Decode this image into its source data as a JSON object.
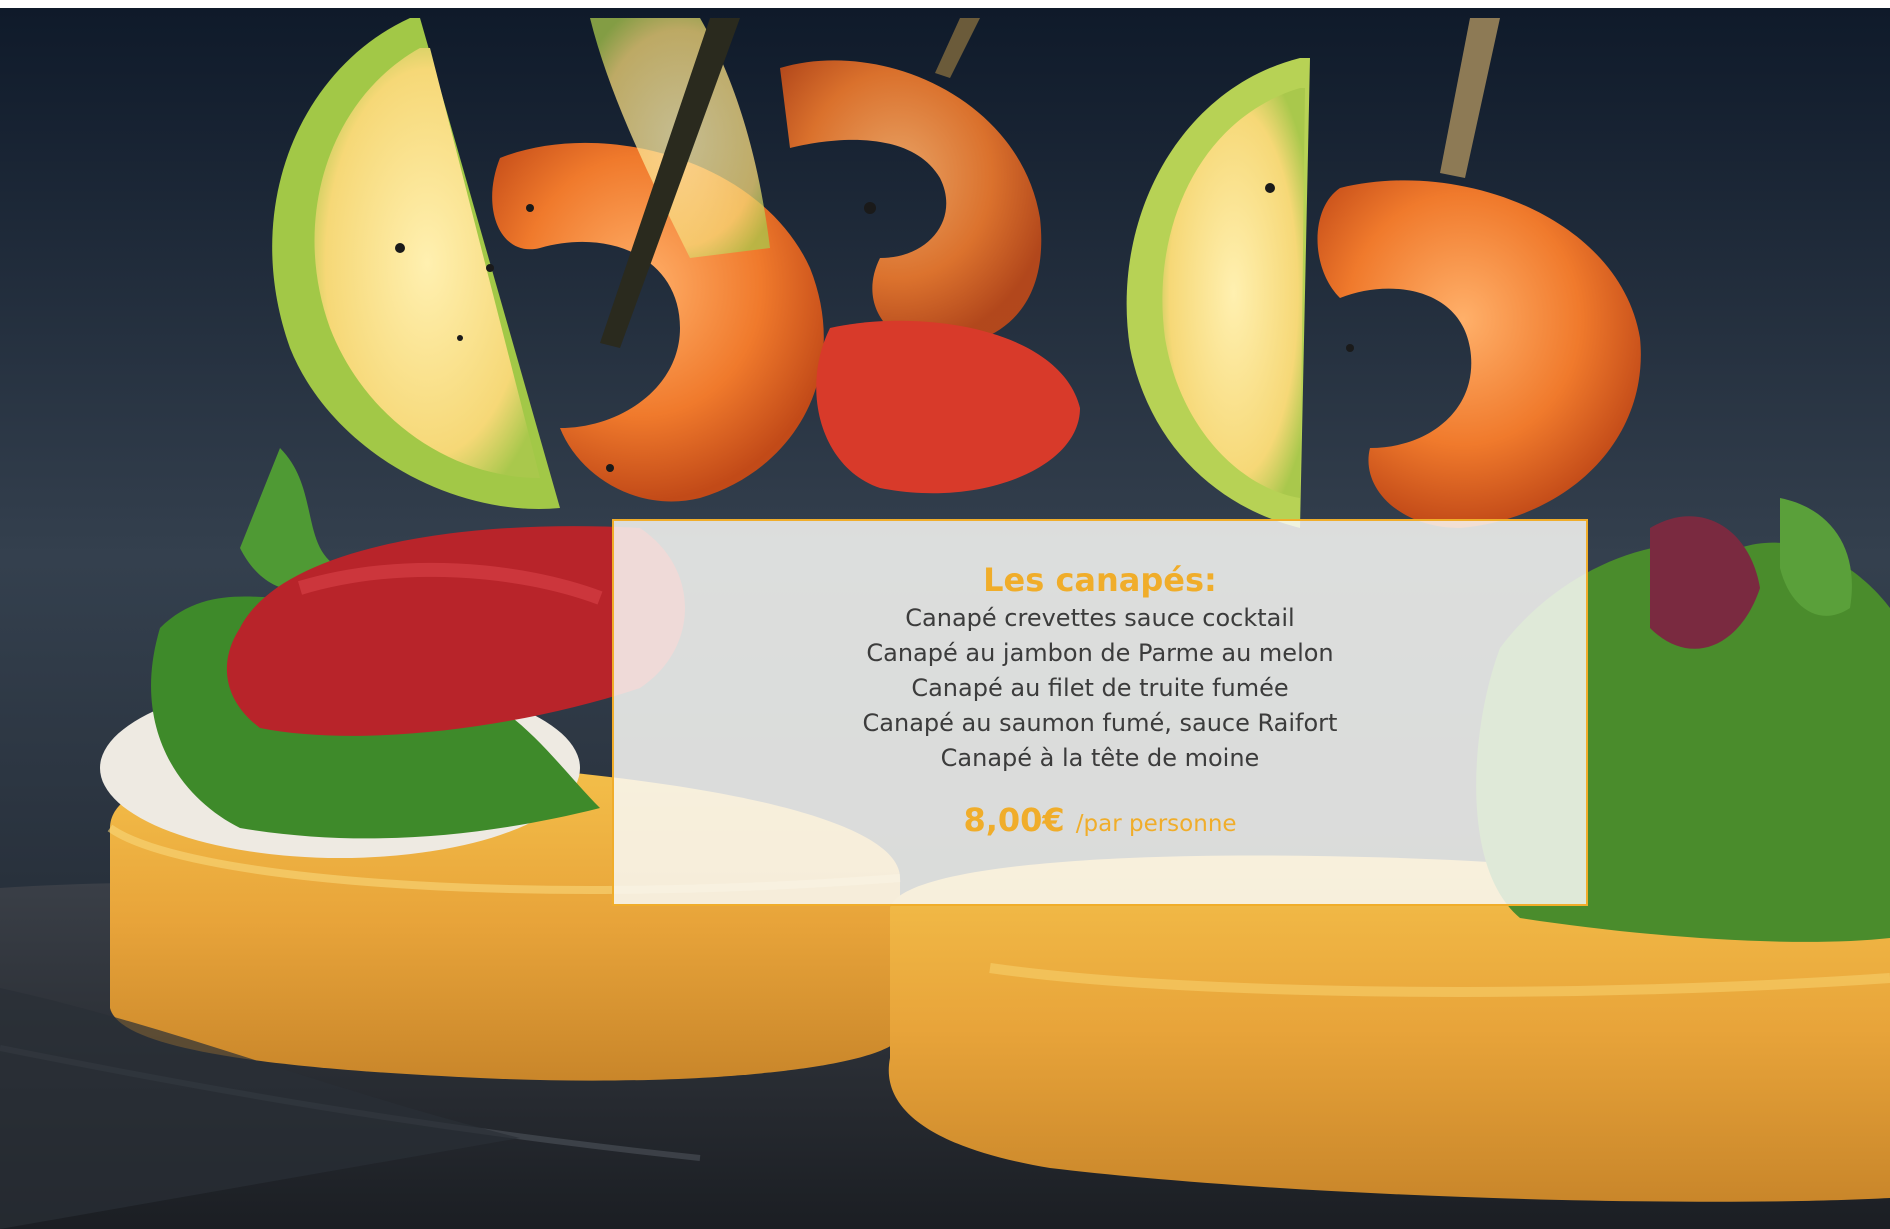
{
  "menu": {
    "title": "Les canapés:",
    "items": [
      {
        "label": "Canapé crevettes sauce cocktail"
      },
      {
        "label": "Canapé au jambon de Parme au melon"
      },
      {
        "label": "Canapé au filet de truite fumée"
      },
      {
        "label": "Canapé au saumon fumé, sauce Raifort"
      },
      {
        "label": "Canapé à la tête de moine"
      }
    ],
    "price": "8,00€",
    "price_unit": "/par personne"
  },
  "colors": {
    "accent": "#f0ad2a",
    "text": "#3c3c3c",
    "card_border": "#f0ad2a"
  }
}
